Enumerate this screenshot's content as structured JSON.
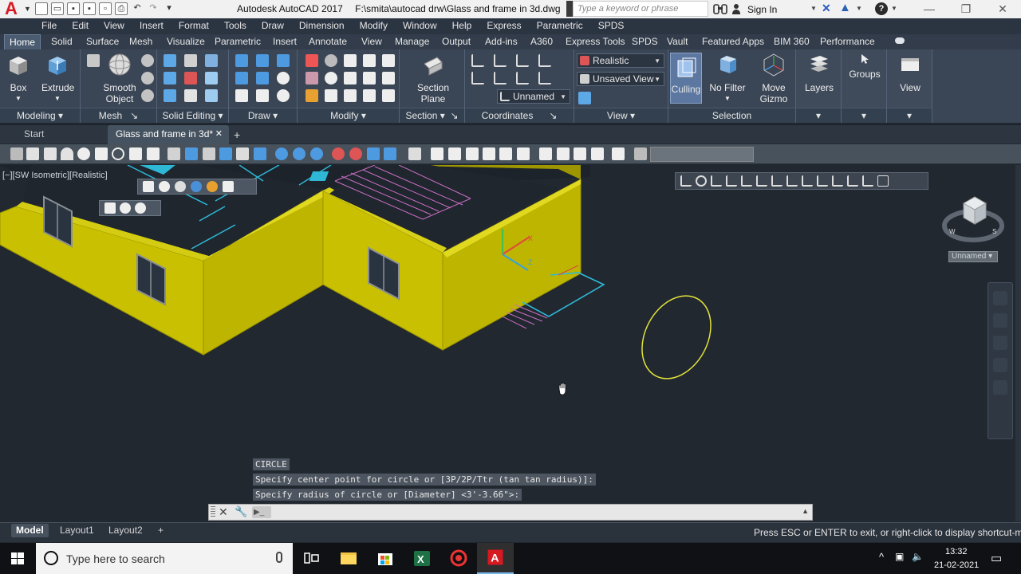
{
  "titlebar": {
    "app_title": "Autodesk AutoCAD 2017",
    "file_path": "F:\\smita\\autocad drw\\Glass and frame in 3d.dwg",
    "search_placeholder": "Type a keyword or phrase",
    "signin_label": "Sign In"
  },
  "menubar": [
    "File",
    "Edit",
    "View",
    "Insert",
    "Format",
    "Tools",
    "Draw",
    "Dimension",
    "Modify",
    "Window",
    "Help",
    "Express",
    "Parametric",
    "SPDS"
  ],
  "ribbon_tabs": [
    "Home",
    "Solid",
    "Surface",
    "Mesh",
    "Visualize",
    "Parametric",
    "Insert",
    "Annotate",
    "View",
    "Manage",
    "Output",
    "Add-ins",
    "A360",
    "Express Tools",
    "SPDS",
    "Vault",
    "Featured Apps",
    "BIM 360",
    "Performance"
  ],
  "ribbon": {
    "modeling": {
      "title": "Modeling",
      "box": "Box",
      "extrude": "Extrude",
      "smooth": "Smooth",
      "object": "Object"
    },
    "mesh": {
      "title": "Mesh"
    },
    "solid_editing": {
      "title": "Solid Editing"
    },
    "draw": {
      "title": "Draw"
    },
    "modify": {
      "title": "Modify"
    },
    "section": {
      "title": "Section",
      "section_label": "Section",
      "plane_label": "Plane"
    },
    "coordinates": {
      "title": "Coordinates",
      "ucs_name": "Unnamed"
    },
    "view": {
      "title": "View",
      "visual_style": "Realistic",
      "saved_view": "Unsaved View"
    },
    "selection": {
      "title": "Selection",
      "culling": "Culling",
      "no_filter": "No Filter",
      "move": "Move",
      "gizmo": "Gizmo"
    },
    "layers": "Layers",
    "groups": "Groups",
    "view_big": "View"
  },
  "file_tabs": {
    "start": "Start",
    "active": "Glass and frame in 3d*"
  },
  "viewport": {
    "label": "[−][SW Isometric][Realistic]",
    "ucs_label": "Unnamed"
  },
  "command": {
    "history": [
      "CIRCLE",
      "Specify center point for circle or [3P/2P/Ttr (tan tan radius)]:",
      "Specify radius of circle or [Diameter] <3'-3.66\">:"
    ]
  },
  "statusbar": {
    "tabs": [
      "Model",
      "Layout1",
      "Layout2"
    ],
    "message": "Press ESC or ENTER to exit, or right-click to display shortcut-menu."
  },
  "taskbar": {
    "search_placeholder": "Type here to search",
    "time": "13:32",
    "date": "21-02-2021"
  },
  "colors": {
    "wall": "#c9c100",
    "accent_cyan": "#2fb7d6",
    "circle": "#e3e33a",
    "autocad_red": "#d71921"
  }
}
